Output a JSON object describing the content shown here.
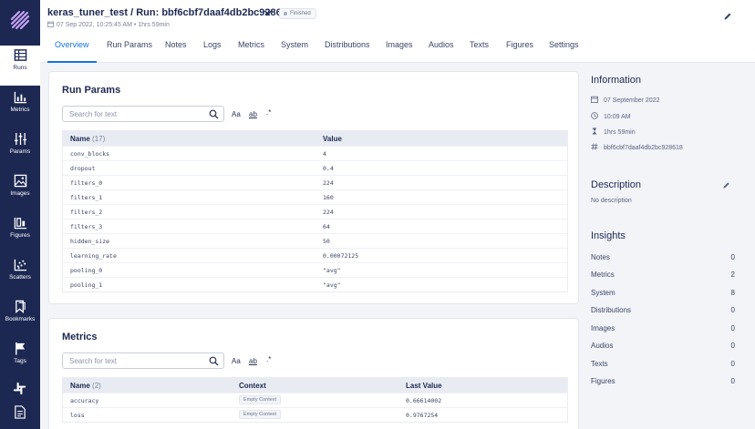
{
  "sidebar": {
    "items": [
      {
        "label": "Runs",
        "icon": "table-icon",
        "active": true
      },
      {
        "label": "Metrics",
        "icon": "chart-icon"
      },
      {
        "label": "Params",
        "icon": "sliders-icon"
      },
      {
        "label": "Images",
        "icon": "image-icon"
      },
      {
        "label": "Figures",
        "icon": "figures-icon"
      },
      {
        "label": "Scatters",
        "icon": "scatter-icon"
      },
      {
        "label": "Bookmarks",
        "icon": "bookmark-icon"
      },
      {
        "label": "Tags",
        "icon": "flag-icon"
      }
    ]
  },
  "header": {
    "title": "keras_tuner_test / Run: bbf6cbf7daaf4db2bc928618",
    "status": "Finished",
    "meta": "07 Sep 2022, 10:25:45 AM • 1hrs 59min"
  },
  "tabs": [
    "Overview",
    "Run Params",
    "Notes",
    "Logs",
    "Metrics",
    "System",
    "Distributions",
    "Images",
    "Audios",
    "Texts",
    "Figures",
    "Settings"
  ],
  "run_params": {
    "title": "Run Params",
    "search_placeholder": "Search for text",
    "col_name": "Name",
    "count": "(17)",
    "col_value": "Value",
    "rows": [
      {
        "name": "conv_blocks",
        "value": "4"
      },
      {
        "name": "dropout",
        "value": "0.4"
      },
      {
        "name": "filters_0",
        "value": "224"
      },
      {
        "name": "filters_1",
        "value": "160"
      },
      {
        "name": "filters_2",
        "value": "224"
      },
      {
        "name": "filters_3",
        "value": "64"
      },
      {
        "name": "hidden_size",
        "value": "50"
      },
      {
        "name": "learning_rate",
        "value": "0.00072125"
      },
      {
        "name": "pooling_0",
        "value": "\"avg\""
      },
      {
        "name": "pooling_1",
        "value": "\"avg\""
      }
    ]
  },
  "metrics": {
    "title": "Metrics",
    "search_placeholder": "Search for text",
    "col_name": "Name",
    "count": "(2)",
    "col_context": "Context",
    "col_last": "Last Value",
    "rows": [
      {
        "name": "accuracy",
        "context": "Empty Context",
        "value": "0.66614002"
      },
      {
        "name": "loss",
        "context": "Empty Context",
        "value": "0.9767254"
      }
    ]
  },
  "search_options": {
    "case": "Aa",
    "word": "ab",
    "regex": ".*"
  },
  "information": {
    "title": "Information",
    "date": "07 September 2022",
    "time": "10:09 AM",
    "duration": "1hrs 59min",
    "hash": "bbf6cbf7daaf4db2bc928618"
  },
  "description": {
    "title": "Description",
    "text": "No description"
  },
  "insights": {
    "title": "Insights",
    "rows": [
      {
        "label": "Notes",
        "value": "0"
      },
      {
        "label": "Metrics",
        "value": "2"
      },
      {
        "label": "System",
        "value": "8"
      },
      {
        "label": "Distributions",
        "value": "0"
      },
      {
        "label": "Images",
        "value": "0"
      },
      {
        "label": "Audios",
        "value": "0"
      },
      {
        "label": "Texts",
        "value": "0"
      },
      {
        "label": "Figures",
        "value": "0"
      }
    ]
  },
  "colors": {
    "sidebar": "#1c2852",
    "accent": "#1473e6",
    "background": "#f2f4f8"
  }
}
